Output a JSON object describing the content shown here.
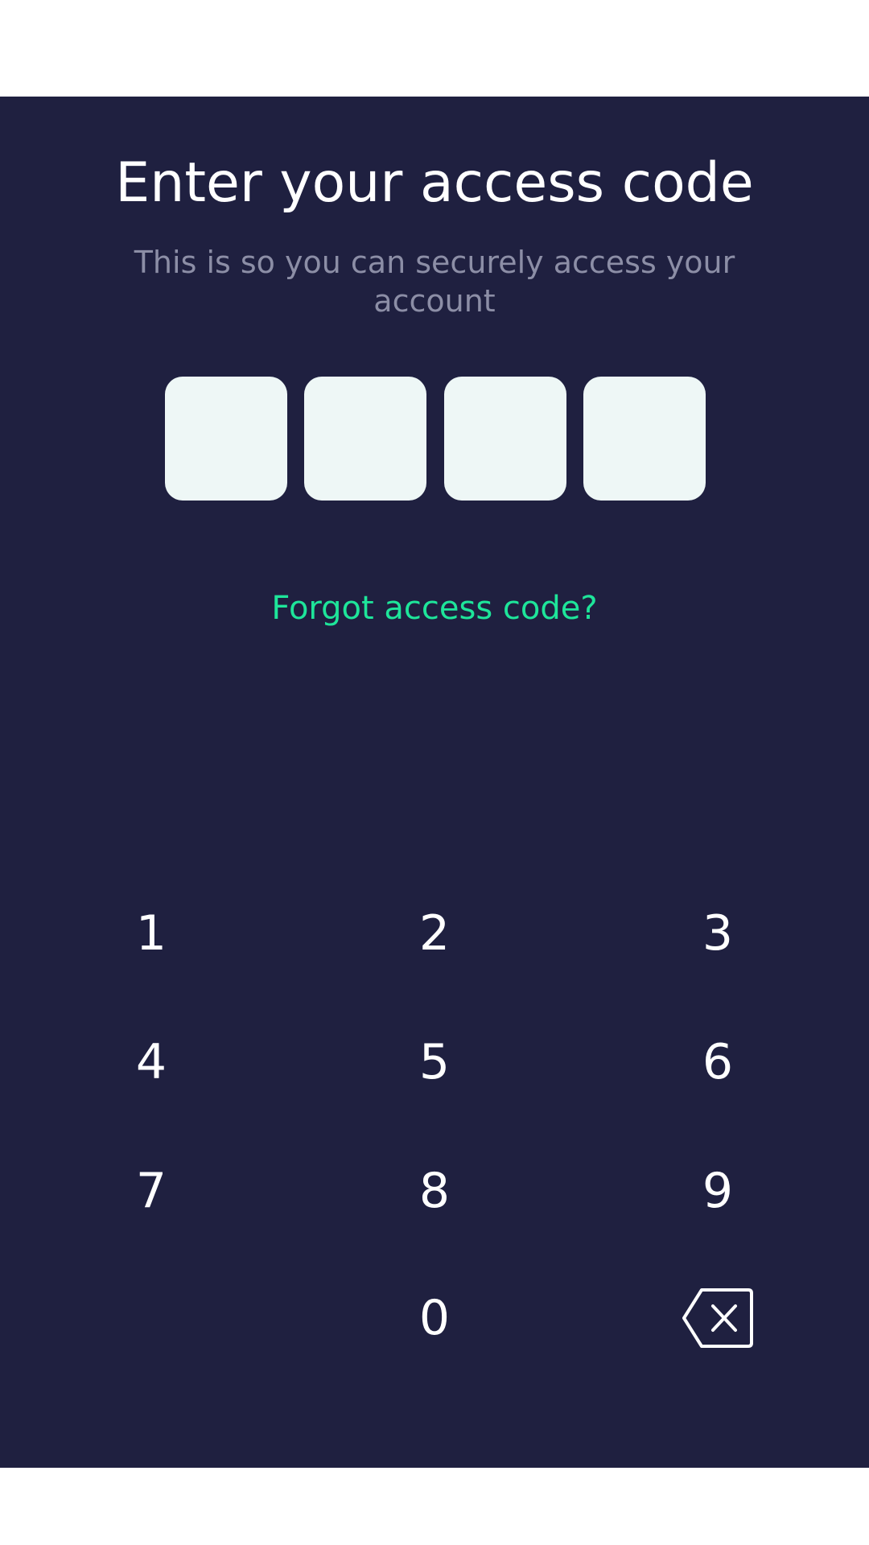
{
  "theme": {
    "background": "#1F2040",
    "accent": "#1EE59A",
    "muted_text": "#8C8EA6",
    "code_box_fill": "#EEF7F6"
  },
  "header": {
    "title": "Enter your access code",
    "subtitle": "This is so you can securely access your account"
  },
  "code_input": {
    "digits": [
      "",
      "",
      "",
      ""
    ]
  },
  "forgot_link": "Forgot access code?",
  "keypad": {
    "keys": [
      "1",
      "2",
      "3",
      "4",
      "5",
      "6",
      "7",
      "8",
      "9",
      "0"
    ],
    "backspace_icon": "backspace-icon"
  }
}
